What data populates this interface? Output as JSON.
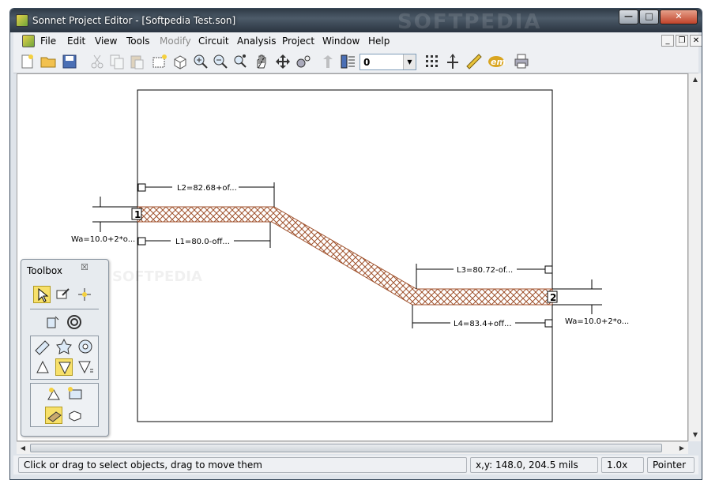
{
  "window": {
    "title": "Sonnet Project Editor - [Softpedia Test.son]",
    "watermark": "SOFTPEDIA"
  },
  "menu": {
    "items": [
      {
        "label": "File",
        "enabled": true
      },
      {
        "label": "Edit",
        "enabled": true
      },
      {
        "label": "View",
        "enabled": true
      },
      {
        "label": "Tools",
        "enabled": true
      },
      {
        "label": "Modify",
        "enabled": false
      },
      {
        "label": "Circuit",
        "enabled": true
      },
      {
        "label": "Analysis",
        "enabled": true
      },
      {
        "label": "Project",
        "enabled": true
      },
      {
        "label": "Window",
        "enabled": true
      },
      {
        "label": "Help",
        "enabled": true
      }
    ]
  },
  "toolbar": {
    "level_value": "0",
    "icons": [
      "new-icon",
      "open-icon",
      "save-icon",
      "cut-icon",
      "copy-icon",
      "paste-icon",
      "select-box-icon",
      "view-3d-icon",
      "zoom-in-icon",
      "zoom-out-icon",
      "zoom-fit-icon",
      "pan-hand-icon",
      "move-icon",
      "reshape-icon",
      "up-level-icon",
      "down-level-icon",
      "grid-icon",
      "snap-icon",
      "ruler-icon",
      "em-icon",
      "print-icon"
    ],
    "em_label": "em"
  },
  "layout_labels": {
    "l2": "L2=82.68+of...",
    "l1": "L1=80.0-off...",
    "l3": "L3=80.72-of...",
    "l4": "L4=83.4+off...",
    "wa_left": "Wa=10.0+2*o...",
    "wa_right": "Wa=10.0+2*o...",
    "port1": "1",
    "port2": "2",
    "watermark": "SOFTPEDIA"
  },
  "toolbox": {
    "title": "Toolbox",
    "close": "☒"
  },
  "status": {
    "message": "Click or drag to select objects, drag to move them",
    "coords": "x,y: 148.0, 204.5 mils",
    "zoom": "1.0x",
    "mode": "Pointer"
  },
  "colors": {
    "trace": "#a0522d",
    "title_bar": "#2e3a46"
  }
}
